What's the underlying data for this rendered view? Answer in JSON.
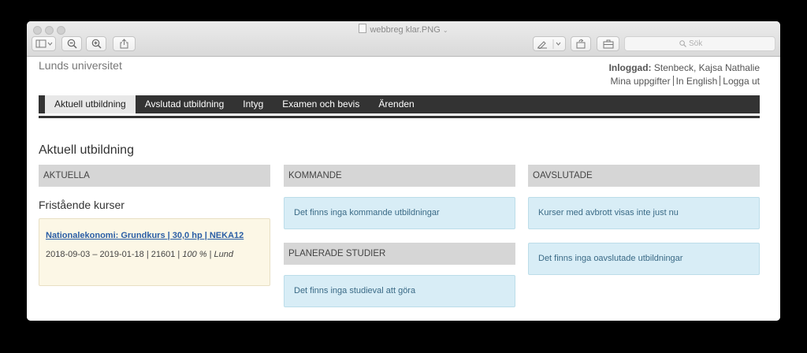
{
  "window": {
    "title": "webbreg klar.PNG",
    "search_placeholder": "Sök"
  },
  "header": {
    "logo": "Lunds universitet",
    "user_label": "Inloggad:",
    "user_name": "Stenbeck, Kajsa Nathalie",
    "links": [
      "Mina uppgifter",
      "In English",
      "Logga ut"
    ]
  },
  "nav": {
    "tabs": [
      "Aktuell utbildning",
      "Avslutad utbildning",
      "Intyg",
      "Examen och bevis",
      "Ärenden"
    ],
    "active_index": 0
  },
  "main": {
    "title": "Aktuell utbildning",
    "columns": {
      "aktuella": {
        "heading": "AKTUELLA",
        "subheading": "Fristående kurser",
        "course": {
          "link": "Nationalekonomi: Grundkurs | 30,0 hp | NEKA12",
          "dates": "2018-09-03 – 2019-01-18",
          "code": "21601",
          "pace": "100 %",
          "location": "Lund"
        }
      },
      "kommande": {
        "heading": "KOMMANDE",
        "message": "Det finns inga kommande utbildningar",
        "planned_heading": "PLANERADE STUDIER",
        "planned_message": "Det finns inga studieval att göra"
      },
      "oavslutade": {
        "heading": "OAVSLUTADE",
        "message1": "Kurser med avbrott visas inte just nu",
        "message2": "Det finns inga oavslutade utbildningar"
      }
    }
  }
}
